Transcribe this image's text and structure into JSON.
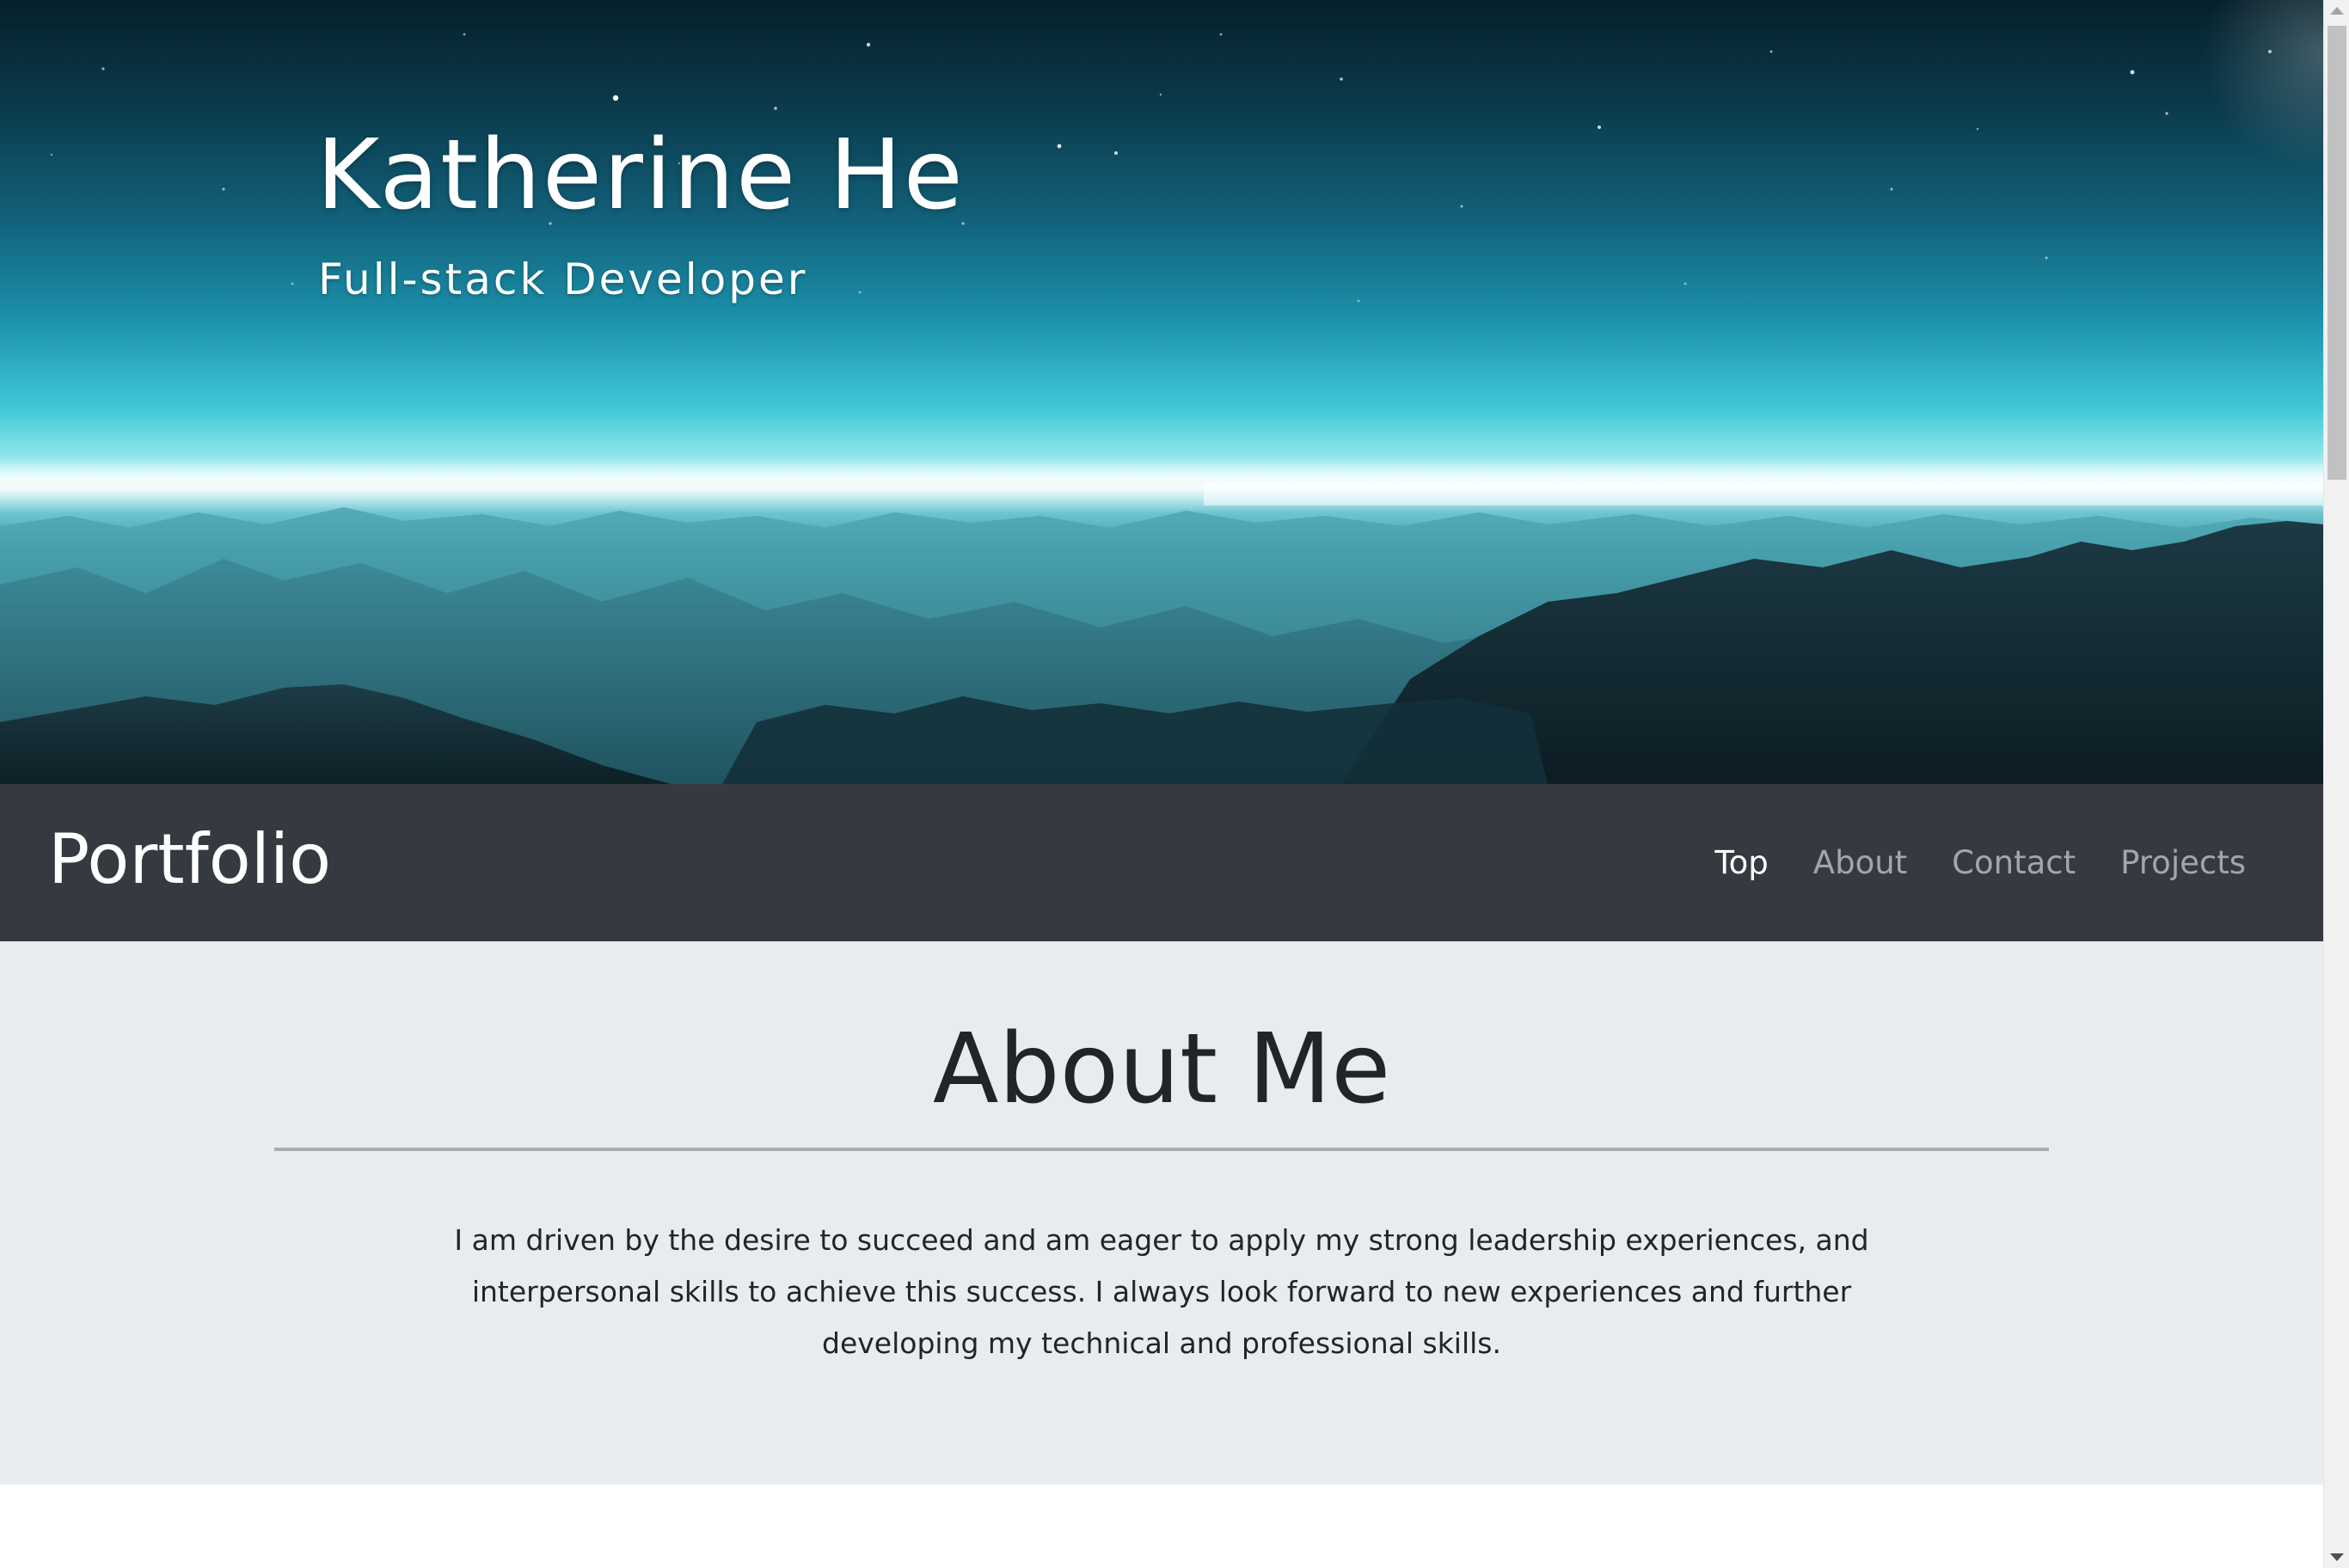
{
  "hero": {
    "name": "Katherine He",
    "role": "Full-stack Developer"
  },
  "navbar": {
    "brand": "Portfolio",
    "links": [
      {
        "label": "Top",
        "active": true
      },
      {
        "label": "About",
        "active": false
      },
      {
        "label": "Contact",
        "active": false
      },
      {
        "label": "Projects",
        "active": false
      }
    ]
  },
  "about": {
    "title": "About Me",
    "text": "I am driven by the desire to succeed and am eager to apply my strong leadership experiences, and interpersonal skills to achieve this success. I always look forward to new experiences and further developing my technical and professional skills."
  },
  "colors": {
    "navbar_bg": "#343a40",
    "about_bg": "#e9ecef",
    "text_dark": "#212529",
    "nav_inactive": "rgba(255,255,255,0.55)",
    "nav_active": "#ffffff"
  },
  "icons": {
    "scroll_up": "scroll-up-arrow-icon",
    "scroll_down": "scroll-down-arrow-icon"
  }
}
